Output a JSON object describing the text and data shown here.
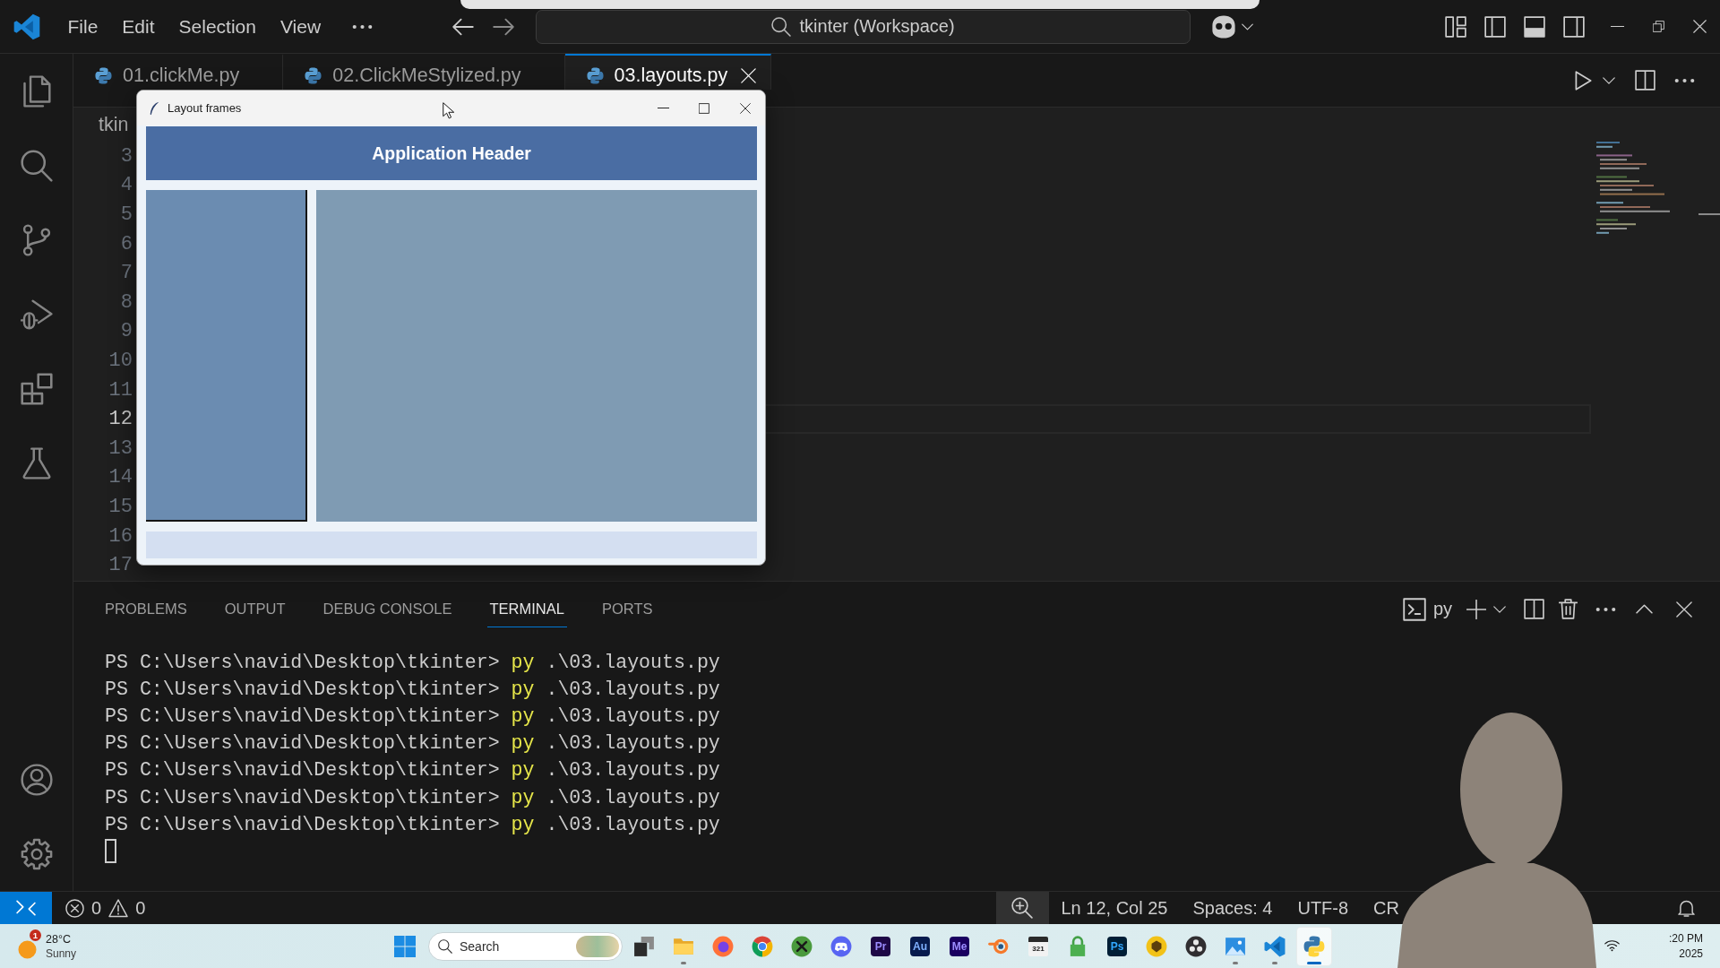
{
  "title_bar": {
    "menu": [
      "File",
      "Edit",
      "Selection",
      "View"
    ],
    "command_center": "tkinter (Workspace)"
  },
  "activity_bar": {
    "top": [
      {
        "kind": "explorer"
      },
      {
        "kind": "search"
      },
      {
        "kind": "source-control"
      },
      {
        "kind": "run-debug"
      },
      {
        "kind": "extensions"
      },
      {
        "kind": "testing"
      }
    ],
    "bottom": [
      {
        "kind": "accounts"
      },
      {
        "kind": "manage"
      }
    ]
  },
  "editor": {
    "tabs": [
      {
        "label": "01.clickMe.py",
        "selected": false
      },
      {
        "label": "02.ClickMeStylized.py",
        "selected": false
      },
      {
        "label": "03.layouts.py",
        "selected": true
      }
    ],
    "breadcrumb": "tkin",
    "lines": [
      {
        "number": "3",
        "current": false
      },
      {
        "number": "4",
        "current": false
      },
      {
        "number": "5",
        "current": false
      },
      {
        "number": "6",
        "current": false
      },
      {
        "number": "7",
        "current": false
      },
      {
        "number": "8",
        "current": false
      },
      {
        "number": "9",
        "current": false
      },
      {
        "number": "10",
        "current": false
      },
      {
        "number": "11",
        "current": false
      },
      {
        "number": "12",
        "current": true
      },
      {
        "number": "13",
        "current": false
      },
      {
        "number": "14",
        "current": false
      },
      {
        "number": "15",
        "current": false
      },
      {
        "number": "16",
        "current": false
      },
      {
        "number": "17",
        "current": false
      }
    ]
  },
  "app_window": {
    "title": "Layout frames",
    "header": "Application Header"
  },
  "panel": {
    "tabs": [
      {
        "label": "PROBLEMS",
        "selected": false
      },
      {
        "label": "OUTPUT",
        "selected": false
      },
      {
        "label": "DEBUG CONSOLE",
        "selected": false
      },
      {
        "label": "TERMINAL",
        "selected": true
      },
      {
        "label": "PORTS",
        "selected": false
      }
    ],
    "terminal_profile": "py",
    "terminal_lines": [
      {
        "prompt": "PS C:\\Users\\navid\\Desktop\\tkinter>",
        "command": "py",
        "arguments": ".\\03.layouts.py"
      },
      {
        "prompt": "PS C:\\Users\\navid\\Desktop\\tkinter>",
        "command": "py",
        "arguments": ".\\03.layouts.py"
      },
      {
        "prompt": "PS C:\\Users\\navid\\Desktop\\tkinter>",
        "command": "py",
        "arguments": ".\\03.layouts.py"
      },
      {
        "prompt": "PS C:\\Users\\navid\\Desktop\\tkinter>",
        "command": "py",
        "arguments": ".\\03.layouts.py"
      },
      {
        "prompt": "PS C:\\Users\\navid\\Desktop\\tkinter>",
        "command": "py",
        "arguments": ".\\03.layouts.py"
      },
      {
        "prompt": "PS C:\\Users\\navid\\Desktop\\tkinter>",
        "command": "py",
        "arguments": ".\\03.layouts.py"
      },
      {
        "prompt": "PS C:\\Users\\navid\\Desktop\\tkinter>",
        "command": "py",
        "arguments": ".\\03.layouts.py"
      }
    ]
  },
  "status_bar": {
    "errors": "0",
    "warnings": "0",
    "items": [
      "Ln 12, Col 25",
      "Spaces: 4",
      "UTF-8",
      "CR"
    ]
  },
  "taskbar": {
    "weather": {
      "badge": "1",
      "temperature": "28°C",
      "condition": "Sunny"
    },
    "search": {
      "placeholder": "Search"
    },
    "apps": [
      {
        "kind": "task-view",
        "running": false,
        "selected": false
      },
      {
        "kind": "file-explorer",
        "running": true,
        "selected": false
      },
      {
        "kind": "firefox",
        "running": false,
        "selected": false
      },
      {
        "kind": "chrome",
        "running": false,
        "selected": false
      },
      {
        "kind": "x-sphere",
        "running": false,
        "selected": false
      },
      {
        "kind": "discord",
        "running": false,
        "selected": false
      },
      {
        "kind": "premiere",
        "label": "Pr",
        "running": false,
        "selected": false
      },
      {
        "kind": "audition",
        "label": "Au",
        "running": false,
        "selected": false
      },
      {
        "kind": "media-encoder",
        "label": "Me",
        "running": false,
        "selected": false
      },
      {
        "kind": "blender",
        "running": false,
        "selected": false
      },
      {
        "kind": "clapper",
        "label": "321",
        "running": false,
        "selected": false
      },
      {
        "kind": "lock",
        "running": false,
        "selected": false
      },
      {
        "kind": "photoshop",
        "label": "Ps",
        "running": false,
        "selected": false
      },
      {
        "kind": "emblem",
        "running": false,
        "selected": false
      },
      {
        "kind": "obs",
        "running": false,
        "selected": false
      },
      {
        "kind": "photos",
        "running": true,
        "selected": false
      },
      {
        "kind": "vscode",
        "running": true,
        "selected": false
      },
      {
        "kind": "python",
        "running": true,
        "selected": true
      }
    ],
    "clock": {
      "time": ":20 PM",
      "date": "2025"
    }
  }
}
